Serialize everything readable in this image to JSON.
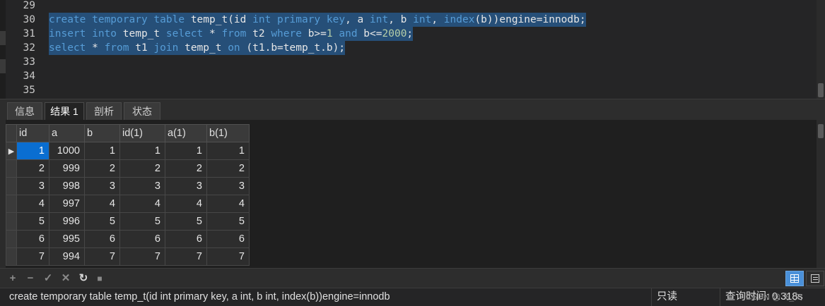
{
  "editor": {
    "lines": [
      {
        "number": "29",
        "tokens": []
      },
      {
        "number": "30",
        "selected": true,
        "tokens": [
          {
            "t": "kw",
            "v": "create "
          },
          {
            "t": "kw",
            "v": "temporary "
          },
          {
            "t": "kw",
            "v": "table "
          },
          {
            "t": "id",
            "v": "temp_t(id "
          },
          {
            "t": "kw",
            "v": "int "
          },
          {
            "t": "kw",
            "v": "primary key"
          },
          {
            "t": "id",
            "v": ", a "
          },
          {
            "t": "kw",
            "v": "int"
          },
          {
            "t": "id",
            "v": ", b "
          },
          {
            "t": "kw",
            "v": "int"
          },
          {
            "t": "id",
            "v": ", "
          },
          {
            "t": "kw",
            "v": "index"
          },
          {
            "t": "id",
            "v": "(b))engine=innodb;"
          }
        ]
      },
      {
        "number": "31",
        "selected": true,
        "tokens": [
          {
            "t": "kw",
            "v": "insert "
          },
          {
            "t": "kw",
            "v": "into "
          },
          {
            "t": "id",
            "v": "temp_t "
          },
          {
            "t": "kw",
            "v": "select "
          },
          {
            "t": "id",
            "v": "* "
          },
          {
            "t": "kw",
            "v": "from "
          },
          {
            "t": "id",
            "v": "t2 "
          },
          {
            "t": "kw",
            "v": "where "
          },
          {
            "t": "id",
            "v": "b>="
          },
          {
            "t": "num",
            "v": "1"
          },
          {
            "t": "id",
            "v": " "
          },
          {
            "t": "kw",
            "v": "and "
          },
          {
            "t": "id",
            "v": "b<="
          },
          {
            "t": "num",
            "v": "2000"
          },
          {
            "t": "id",
            "v": ";"
          }
        ]
      },
      {
        "number": "32",
        "selected": true,
        "tokens": [
          {
            "t": "kw",
            "v": "select "
          },
          {
            "t": "id",
            "v": "* "
          },
          {
            "t": "kw",
            "v": "from "
          },
          {
            "t": "id",
            "v": "t1 "
          },
          {
            "t": "kw",
            "v": "join "
          },
          {
            "t": "id",
            "v": "temp_t "
          },
          {
            "t": "kw",
            "v": "on "
          },
          {
            "t": "id",
            "v": "(t1.b=temp_t.b);"
          }
        ]
      },
      {
        "number": "33",
        "tokens": []
      },
      {
        "number": "34",
        "tokens": []
      },
      {
        "number": "35",
        "tokens": []
      }
    ]
  },
  "tabs": [
    {
      "label": "信息",
      "active": false
    },
    {
      "label": "结果 1",
      "active": true
    },
    {
      "label": "剖析",
      "active": false
    },
    {
      "label": "状态",
      "active": false
    }
  ],
  "result_grid": {
    "columns": [
      "id",
      "a",
      "b",
      "id(1)",
      "a(1)",
      "b(1)"
    ],
    "rows": [
      [
        "1",
        "1000",
        "1",
        "1",
        "1",
        "1"
      ],
      [
        "2",
        "999",
        "2",
        "2",
        "2",
        "2"
      ],
      [
        "3",
        "998",
        "3",
        "3",
        "3",
        "3"
      ],
      [
        "4",
        "997",
        "4",
        "4",
        "4",
        "4"
      ],
      [
        "5",
        "996",
        "5",
        "5",
        "5",
        "5"
      ],
      [
        "6",
        "995",
        "6",
        "6",
        "6",
        "6"
      ],
      [
        "7",
        "994",
        "7",
        "7",
        "7",
        "7"
      ]
    ],
    "current_row_marker": "▶"
  },
  "toolbar": {
    "add_glyph": "+",
    "delete_glyph": "−",
    "apply_glyph": "✓",
    "discard_glyph": "✕",
    "refresh_glyph": "↻",
    "stop_glyph": "■"
  },
  "statusbar": {
    "query": "create temporary table temp_t(id int primary key, a int, b int, index(b))engine=innodb",
    "mode": "只读",
    "elapsed": "查询时间: 0.318s",
    "watermark": "CSDN @飞_欠"
  },
  "colors": {
    "keyword": "#569cd6",
    "identifier": "#e6e6e6",
    "number": "#b5cea8",
    "selection": "#264f78",
    "active_cell": "#0a6ed1",
    "active_view_button": "#4a90d9"
  }
}
